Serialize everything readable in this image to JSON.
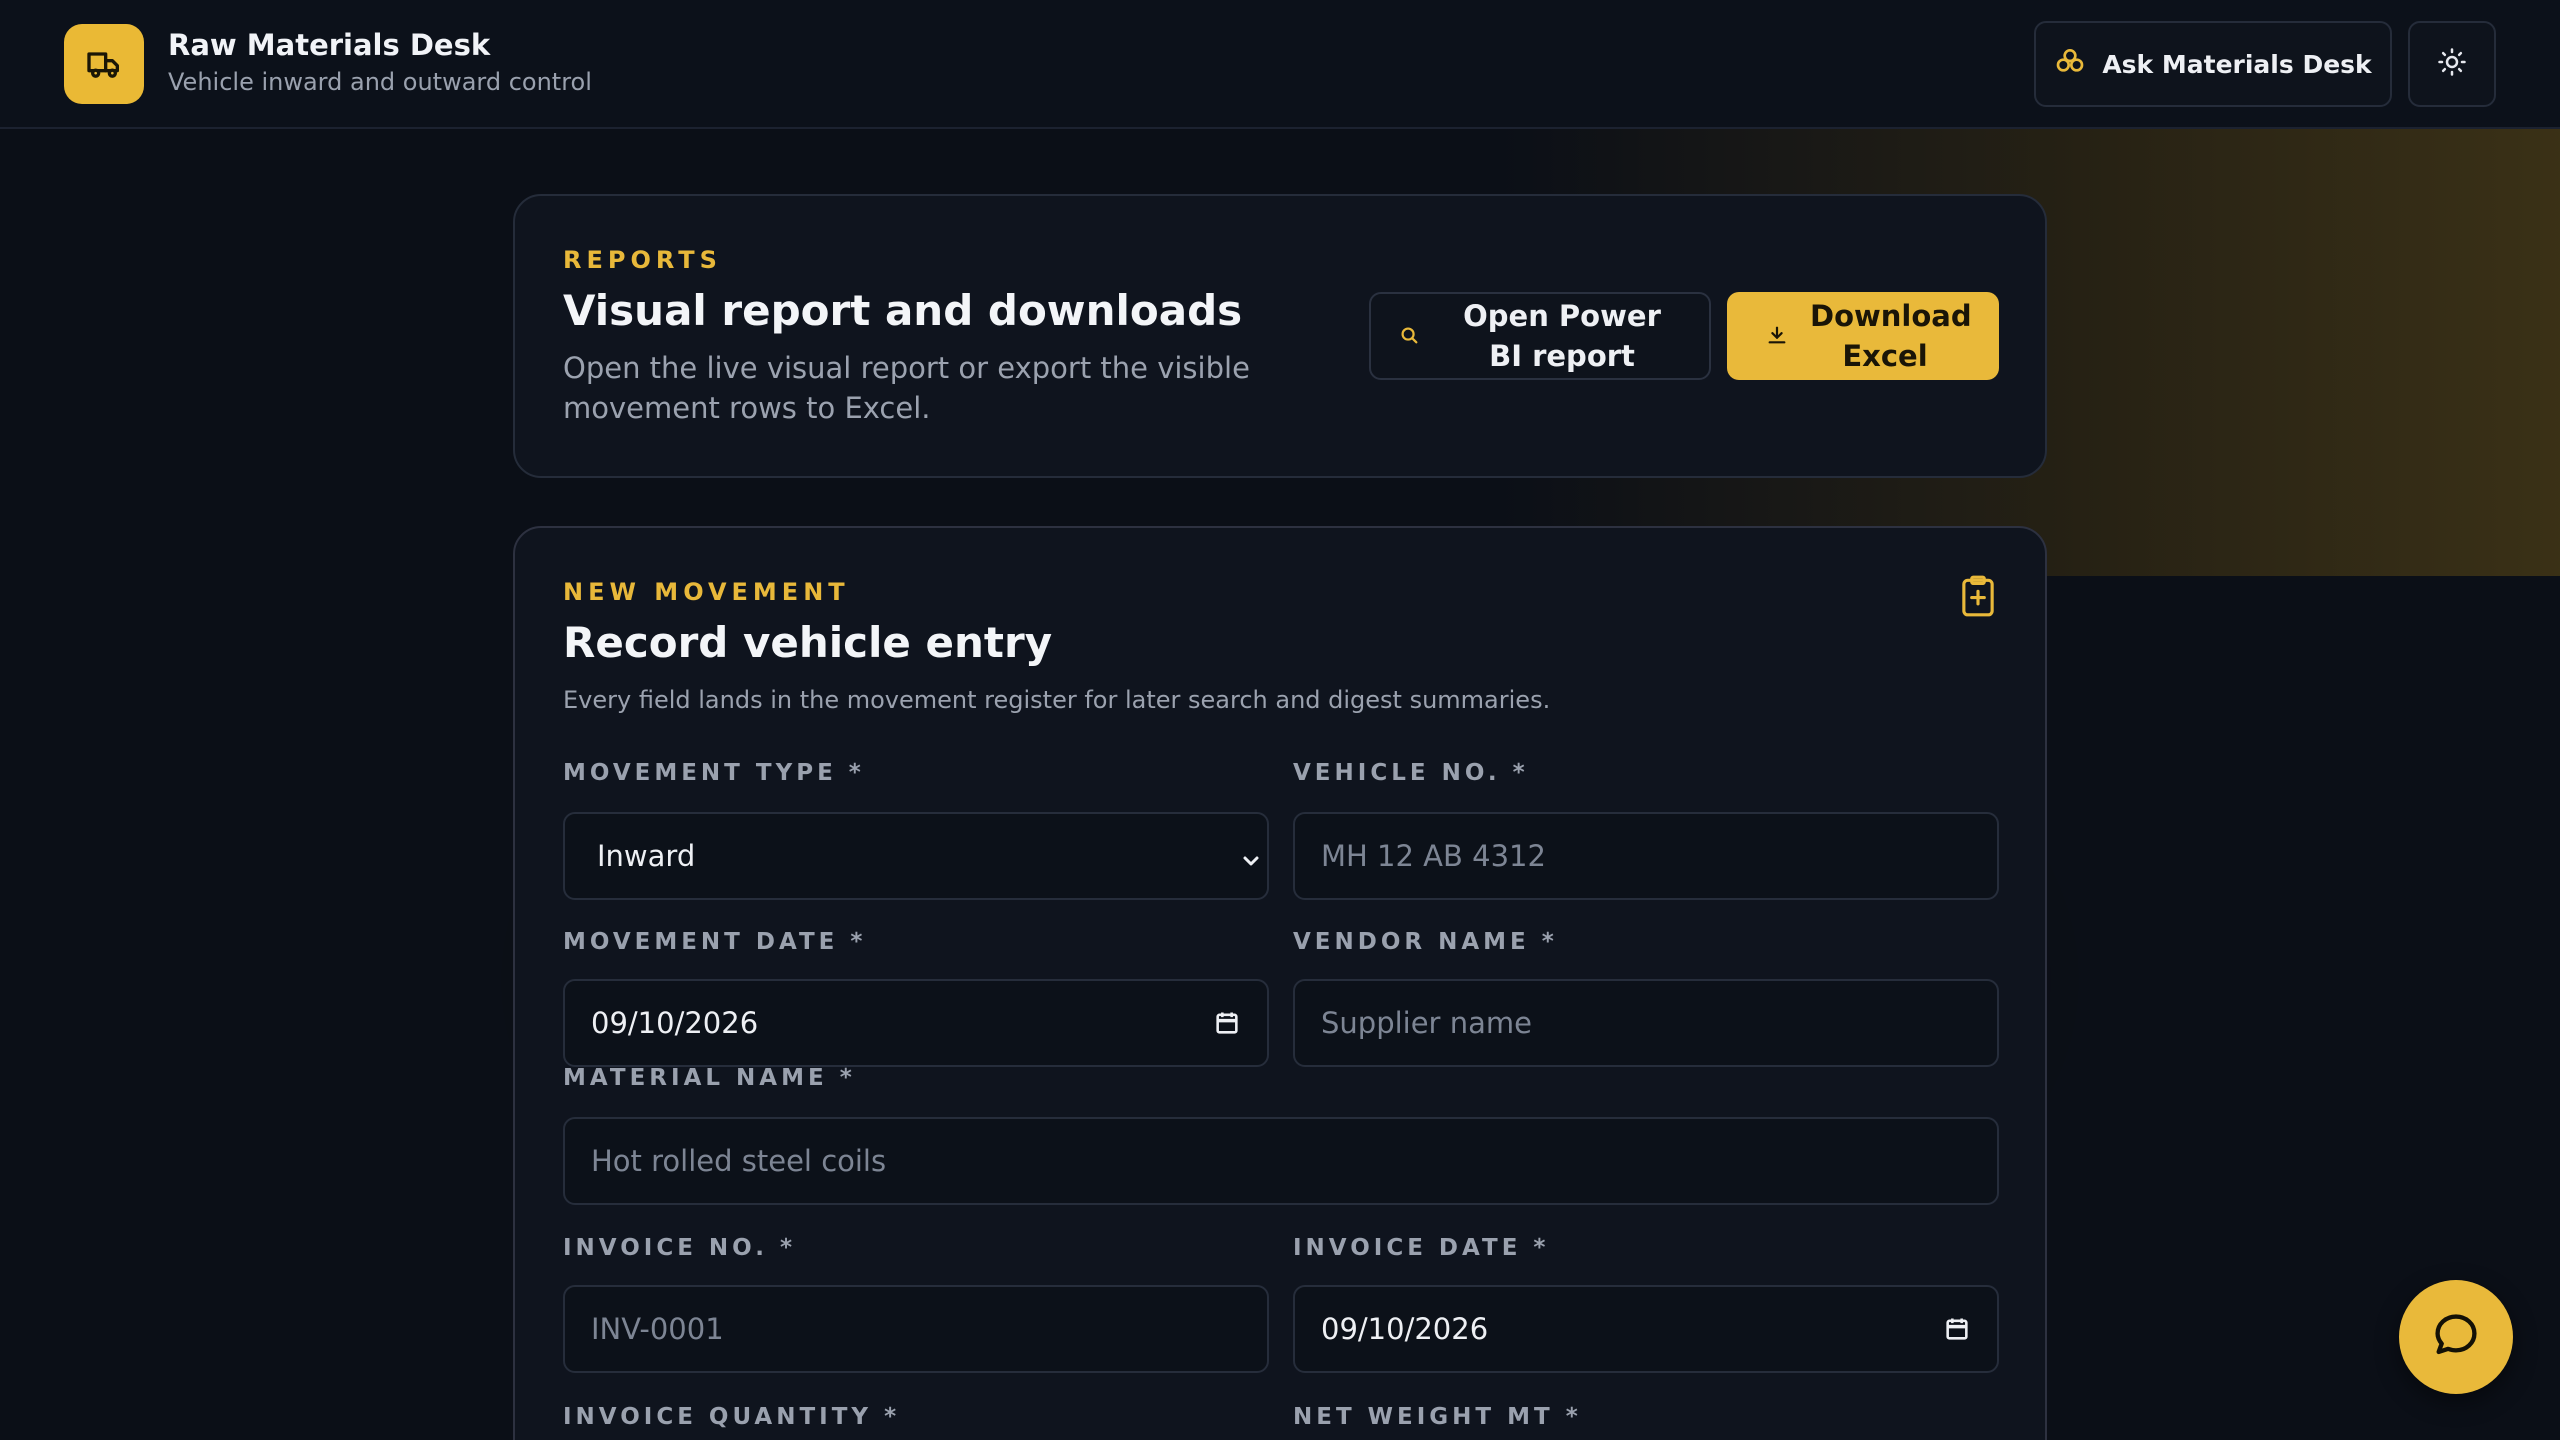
{
  "header": {
    "app_title": "Raw Materials Desk",
    "app_subtitle": "Vehicle inward and outward control",
    "logo_icon": "truck-icon",
    "ask_label": "Ask Materials Desk",
    "ask_icon": "sparkles-icon",
    "theme_icon": "sun-icon"
  },
  "reports": {
    "eyebrow": "REPORTS",
    "title": "Visual report and downloads",
    "description": "Open the live visual report or export the visible movement rows to Excel.",
    "powerbi_label": "Open Power BI report",
    "powerbi_icon": "search-icon",
    "download_label": "Download Excel",
    "download_icon": "download-icon"
  },
  "movement": {
    "eyebrow": "NEW MOVEMENT",
    "title": "Record vehicle entry",
    "description": "Every field lands in the movement register for later search and digest summaries.",
    "header_icon": "clipboard-plus-icon",
    "fields": {
      "movement_type": {
        "label": "MOVEMENT TYPE *",
        "value": "Inward"
      },
      "vehicle_no": {
        "label": "VEHICLE NO. *",
        "placeholder": "MH 12 AB 4312"
      },
      "movement_date": {
        "label": "MOVEMENT DATE *",
        "value": "09/10/2026"
      },
      "vendor_name": {
        "label": "VENDOR NAME *",
        "placeholder": "Supplier name"
      },
      "material_name": {
        "label": "MATERIAL NAME *",
        "placeholder": "Hot rolled steel coils"
      },
      "invoice_no": {
        "label": "INVOICE NO. *",
        "placeholder": "INV-0001"
      },
      "invoice_date": {
        "label": "INVOICE DATE *",
        "value": "09/10/2026"
      },
      "invoice_quantity": {
        "label": "INVOICE QUANTITY *"
      },
      "net_weight": {
        "label": "NET WEIGHT MT *"
      }
    }
  },
  "chat": {
    "icon": "chat-bubble-icon"
  },
  "colors": {
    "accent": "#e9b93a",
    "background": "#0b0f17",
    "card": "#0f141e"
  }
}
